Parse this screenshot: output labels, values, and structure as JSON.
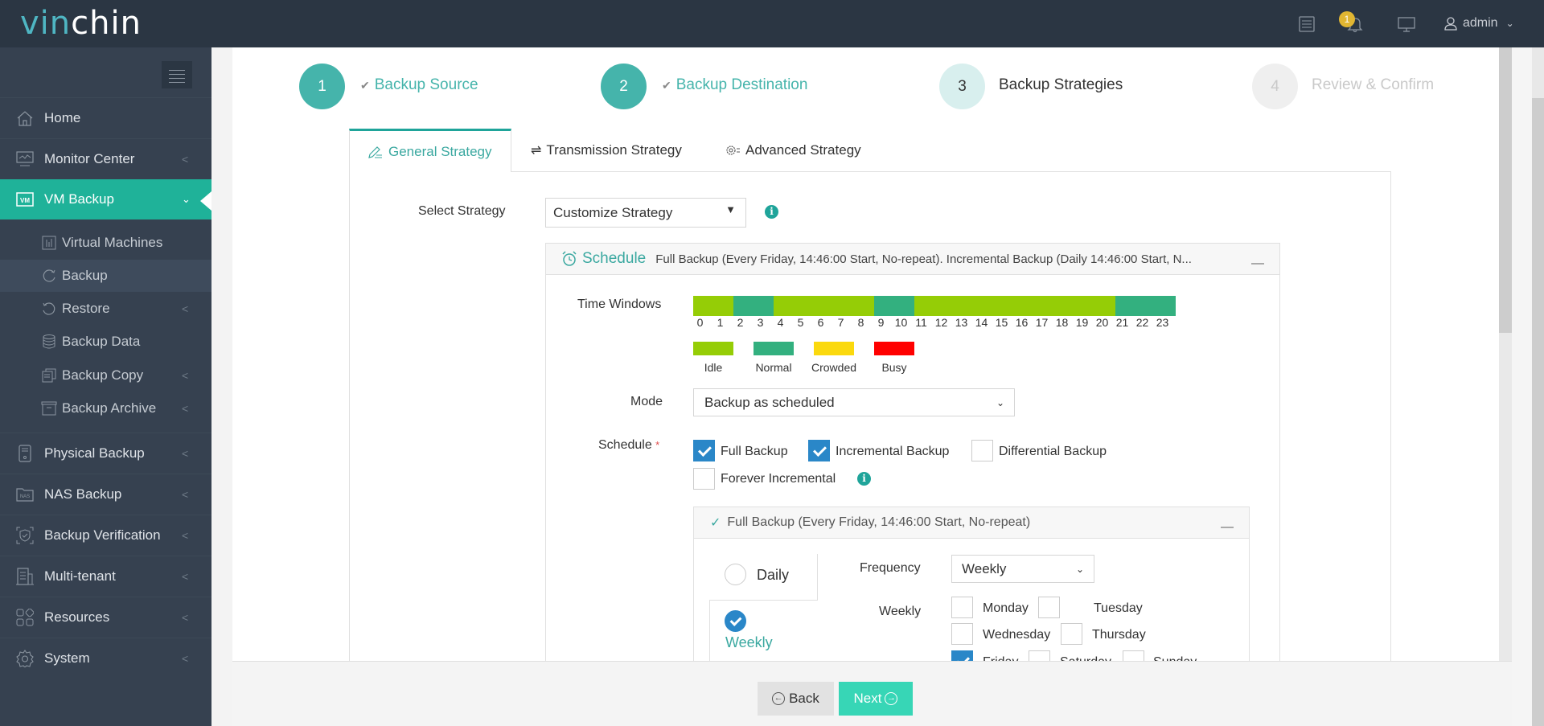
{
  "header": {
    "logo_part1": "vin",
    "logo_part2": "chin",
    "notification_count": "1",
    "user": "admin",
    "icons": [
      "task-list-icon",
      "bell-icon",
      "monitor-icon",
      "user-icon"
    ]
  },
  "sidebar": {
    "items": [
      {
        "label": "Home",
        "icon": "home-icon"
      },
      {
        "label": "Monitor Center",
        "icon": "monitor-chart-icon"
      },
      {
        "label": "VM Backup",
        "icon": "vm-icon",
        "active": true
      },
      {
        "label": "Physical Backup",
        "icon": "physical-server-icon"
      },
      {
        "label": "NAS Backup",
        "icon": "nas-icon"
      },
      {
        "label": "Backup Verification",
        "icon": "shield-check-icon"
      },
      {
        "label": "Multi-tenant",
        "icon": "building-icon"
      },
      {
        "label": "Resources",
        "icon": "resources-icon"
      },
      {
        "label": "System",
        "icon": "gear-icon"
      }
    ],
    "vm_backup_sub": [
      {
        "label": "Virtual Machines",
        "icon": "vm-list-icon"
      },
      {
        "label": "Backup",
        "icon": "refresh-icon",
        "hover": true
      },
      {
        "label": "Restore",
        "icon": "restore-icon"
      },
      {
        "label": "Backup Data",
        "icon": "database-icon"
      },
      {
        "label": "Backup Copy",
        "icon": "copy-icon"
      },
      {
        "label": "Backup Archive",
        "icon": "archive-icon"
      }
    ]
  },
  "steps": [
    {
      "number": "1",
      "label": "Backup Source",
      "state": "done"
    },
    {
      "number": "2",
      "label": "Backup Destination",
      "state": "done"
    },
    {
      "number": "3",
      "label": "Backup Strategies",
      "state": "current"
    },
    {
      "number": "4",
      "label": "Review & Confirm",
      "state": "todo"
    }
  ],
  "tabs": [
    {
      "label": "General Strategy",
      "active": true
    },
    {
      "label": "Transmission Strategy"
    },
    {
      "label": "Advanced Strategy"
    }
  ],
  "strategy": {
    "label": "Select Strategy",
    "value": "Customize Strategy"
  },
  "schedule_panel": {
    "title": "Schedule",
    "summary": "Full Backup (Every Friday, 14:46:00 Start, No-repeat). Incremental Backup (Daily 14:46:00 Start, N..."
  },
  "time_windows": {
    "label": "Time Windows",
    "hours": [
      "0",
      "1",
      "2",
      "3",
      "4",
      "5",
      "6",
      "7",
      "8",
      "9",
      "10",
      "11",
      "12",
      "13",
      "14",
      "15",
      "16",
      "17",
      "18",
      "19",
      "20",
      "21",
      "22",
      "23"
    ],
    "status_by_hour": [
      "idle",
      "idle",
      "normal",
      "normal",
      "idle",
      "idle",
      "idle",
      "idle",
      "idle",
      "normal",
      "normal",
      "idle",
      "idle",
      "idle",
      "idle",
      "idle",
      "idle",
      "idle",
      "idle",
      "idle",
      "idle",
      "normal",
      "normal",
      "normal"
    ],
    "legend": [
      {
        "key": "idle",
        "label": "Idle",
        "color": "#95cd06"
      },
      {
        "key": "normal",
        "label": "Normal",
        "color": "#33b07f"
      },
      {
        "key": "crowded",
        "label": "Crowded",
        "color": "#fbd90e"
      },
      {
        "key": "busy",
        "label": "Busy",
        "color": "#ff0000"
      }
    ]
  },
  "mode": {
    "label": "Mode",
    "value": "Backup as scheduled"
  },
  "schedule": {
    "label": "Schedule",
    "required_mark": "*",
    "options": [
      {
        "label": "Full Backup",
        "checked": true
      },
      {
        "label": "Incremental Backup",
        "checked": true
      },
      {
        "label": "Differential Backup",
        "checked": false
      },
      {
        "label": "Forever Incremental",
        "checked": false
      }
    ]
  },
  "full_backup": {
    "header": "Full Backup (Every Friday, 14:46:00 Start, No-repeat)",
    "radios": [
      {
        "label": "Daily",
        "selected": false
      },
      {
        "label": "Weekly",
        "selected": true
      }
    ],
    "frequency_label": "Frequency",
    "frequency_value": "Weekly",
    "weekly_label": "Weekly",
    "days": [
      {
        "label": "Monday",
        "checked": false
      },
      {
        "label": "Tuesday",
        "checked": false
      },
      {
        "label": "Wednesday",
        "checked": false
      },
      {
        "label": "Thursday",
        "checked": false
      },
      {
        "label": "Friday",
        "checked": true
      },
      {
        "label": "Saturday",
        "checked": false
      },
      {
        "label": "Sunday",
        "checked": false
      }
    ]
  },
  "footer": {
    "back_label": "Back",
    "next_label": "Next"
  },
  "colors": {
    "accent": "#1fb299",
    "header_bg": "#2b3643",
    "sidebar_bg": "#364150",
    "checkbox_blue": "#2a87c8",
    "next_button": "#37d6b6"
  }
}
